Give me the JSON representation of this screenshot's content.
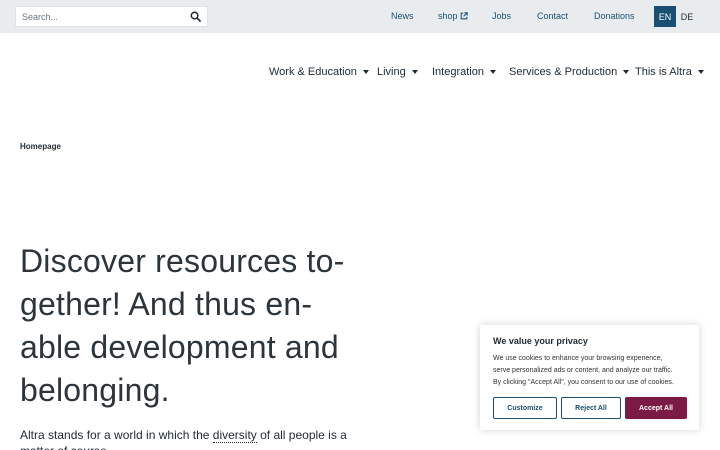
{
  "topbar": {
    "search_placeholder": "Search...",
    "links": {
      "news": "News",
      "shop": "shop",
      "jobs": "Jobs",
      "contact": "Contact",
      "donations": "Donations"
    },
    "languages": {
      "en": "EN",
      "de": "DE"
    },
    "active_language": "EN"
  },
  "nav": {
    "work": "Work & Education",
    "living": "Living",
    "integration": "Integration",
    "services": "Services & Production",
    "about": "This is Altra"
  },
  "breadcrumb": "Homepage",
  "hero": {
    "line1": "Discover resources to-",
    "line2": "gether! And thus en-",
    "line3": "able development and",
    "line4": "belonging."
  },
  "intro": {
    "before": "Altra stands for a world in which the ",
    "highlight": "diversity",
    "after": " of all people is a matter of course."
  },
  "cookie": {
    "title": "We value your privacy",
    "line1": "We use cookies to enhance your browsing experience,",
    "line2": "serve personalized ads or content, and analyze our traffic.",
    "line3": "By clicking \"Accept All\", you consent to our use of cookies.",
    "customize": "Customize",
    "reject": "Reject All",
    "accept": "Accept All"
  },
  "colors": {
    "brand_blue": "#1a4f73",
    "accept_maroon": "#7b1b45",
    "topbar_bg": "#e9ecee"
  }
}
